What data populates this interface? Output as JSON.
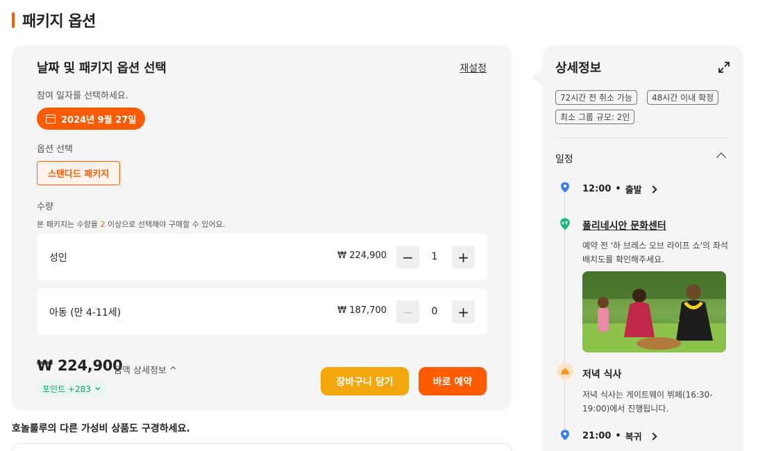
{
  "page_title": "패키지 옵션",
  "booking": {
    "heading": "날짜 및 패키지 옵션 선택",
    "reset_label": "재설정",
    "date_prompt": "참여 일자를 선택하세요.",
    "selected_date": "2024년 9월 27일",
    "option_label": "옵션 선택",
    "selected_option": "스탠다드 패키지",
    "quantity_label": "수량",
    "quantity_note_before": "본 패키지는 수량을 ",
    "quantity_note_number": "2",
    "quantity_note_after": " 이상으로 선택해야 구매할 수 있어요.",
    "tickets": [
      {
        "name": "성인",
        "price": "₩ 224,900",
        "count": "1",
        "minus_enabled": true
      },
      {
        "name": "아동 (만 4-11세)",
        "price": "₩ 187,700",
        "count": "0",
        "minus_enabled": false
      }
    ],
    "total_price": "₩ 224,900",
    "price_detail_label": "금액 상세정보 ^",
    "points_label": "포인트 +283",
    "add_to_cart_label": "장바구니 담기",
    "book_now_label": "바로 예약"
  },
  "more_products_text": "호놀룰루의 다른 가성비 상품도 구경하세요.",
  "details": {
    "title": "상세정보",
    "tags": [
      "72시간 전 취소 가능",
      "48시간 이내 확정",
      "최소 그룹 규모:  2인"
    ],
    "schedule_label": "일정",
    "start": {
      "time": "12:00",
      "sep": "•",
      "label": "출발"
    },
    "place_name": "폴리네시안 문화센터",
    "place_desc": "예약 전 '하 브레스 오브 라이프 쇼'의 좌석 배치도를 확인해주세요.",
    "dinner_title": "저녁 식사",
    "dinner_desc": "저녁 식사는 게이트웨이 뷔페(16:30-19:00)에서 진행됩니다.",
    "end": {
      "time": "21:00",
      "sep": "•",
      "label": "복귀"
    }
  },
  "colors": {
    "accent": "#ff5b00",
    "cart": "#f2a70c",
    "points": "#13a26a",
    "pin": "#3d7cf2"
  },
  "icons": [
    "calendar-icon",
    "minus-icon",
    "plus-icon",
    "chevron-down-icon",
    "expand-icon",
    "chevron-up-icon",
    "location-pin-icon",
    "landmark-pin-icon",
    "dinner-bell-icon",
    "chevron-right-icon"
  ]
}
